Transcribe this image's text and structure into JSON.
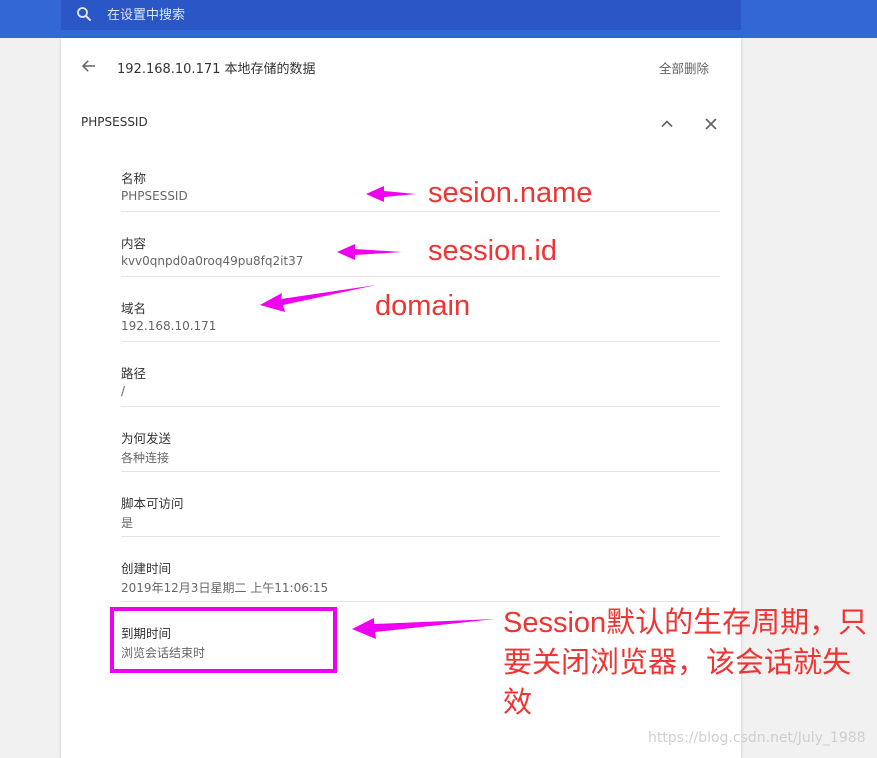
{
  "search": {
    "placeholder": "在设置中搜索"
  },
  "header": {
    "title": "192.168.10.171 本地存储的数据",
    "delete_all_label": "全部删除"
  },
  "cookie": {
    "name": "PHPSESSID"
  },
  "fields": [
    {
      "label": "名称",
      "value": "PHPSESSID"
    },
    {
      "label": "内容",
      "value": "kvv0qnpd0a0roq49pu8fq2it37"
    },
    {
      "label": "域名",
      "value": "192.168.10.171"
    },
    {
      "label": "路径",
      "value": "/"
    },
    {
      "label": "为何发送",
      "value": "各种连接"
    },
    {
      "label": "脚本可访问",
      "value": "是"
    },
    {
      "label": "创建时间",
      "value": "2019年12月3日星期二 上午11:06:15"
    },
    {
      "label": "到期时间",
      "value": "浏览会话结束时"
    }
  ],
  "annotations": {
    "name": "sesion.name",
    "id": "session.id",
    "domain": "domain",
    "expiry": "Session默认的生存周期，只要关闭浏览器，该会话就失效"
  },
  "watermark": "https://blog.csdn.net/July_1988",
  "colors": {
    "topbar": "#3367d6",
    "annotation_text": "#ef3434",
    "annotation_mark": "#f000f0"
  },
  "icons": [
    "search-icon",
    "back-arrow-icon",
    "chevron-up-icon",
    "close-icon"
  ]
}
